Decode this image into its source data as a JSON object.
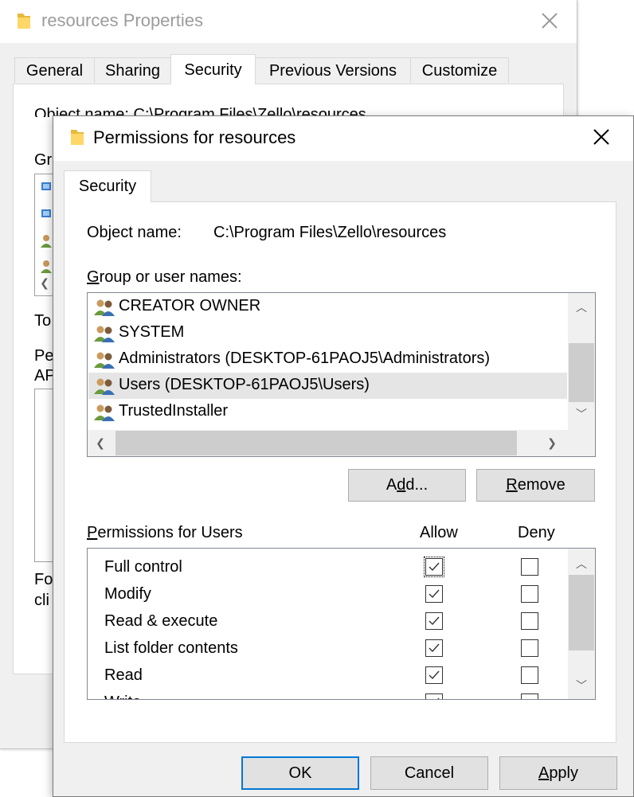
{
  "background_window": {
    "title": "resources Properties",
    "tabs": [
      "General",
      "Sharing",
      "Security",
      "Previous Versions",
      "Customize"
    ],
    "active_tab": "Security",
    "fragments": {
      "object_name": "Object name:     C:\\Program Files\\Zello\\resources",
      "group_label": "Gr",
      "to": "To",
      "pe": "Pe",
      "ap": "AP",
      "fo": "Fo",
      "cli": "cli"
    }
  },
  "dialog": {
    "title": "Permissions for resources",
    "tab": "Security",
    "object_name_label": "Object name:",
    "object_name_value": "C:\\Program Files\\Zello\\resources",
    "group_label": "Group or user names:",
    "groups": [
      {
        "name": "CREATOR OWNER",
        "icon": "user-group-icon"
      },
      {
        "name": "SYSTEM",
        "icon": "user-group-icon"
      },
      {
        "name": "Administrators (DESKTOP-61PAOJ5\\Administrators)",
        "icon": "user-group-icon"
      },
      {
        "name": "Users (DESKTOP-61PAOJ5\\Users)",
        "icon": "user-group-icon",
        "selected": true
      },
      {
        "name": "TrustedInstaller",
        "icon": "user-group-icon"
      }
    ],
    "add_button": "Add...",
    "remove_button": "Remove",
    "permissions_label": "Permissions for Users",
    "allow_header": "Allow",
    "deny_header": "Deny",
    "permissions": [
      {
        "name": "Full control",
        "allow": true,
        "deny": false
      },
      {
        "name": "Modify",
        "allow": true,
        "deny": false
      },
      {
        "name": "Read & execute",
        "allow": true,
        "deny": false
      },
      {
        "name": "List folder contents",
        "allow": true,
        "deny": false
      },
      {
        "name": "Read",
        "allow": true,
        "deny": false
      },
      {
        "name": "Write",
        "allow": true,
        "deny": false
      }
    ],
    "ok_button": "OK",
    "cancel_button": "Cancel",
    "apply_button": "Apply"
  },
  "colors": {
    "window_bg": "#f0f0f0",
    "selected_row": "#e5e5e5",
    "default_button_border": "#0078d7"
  }
}
